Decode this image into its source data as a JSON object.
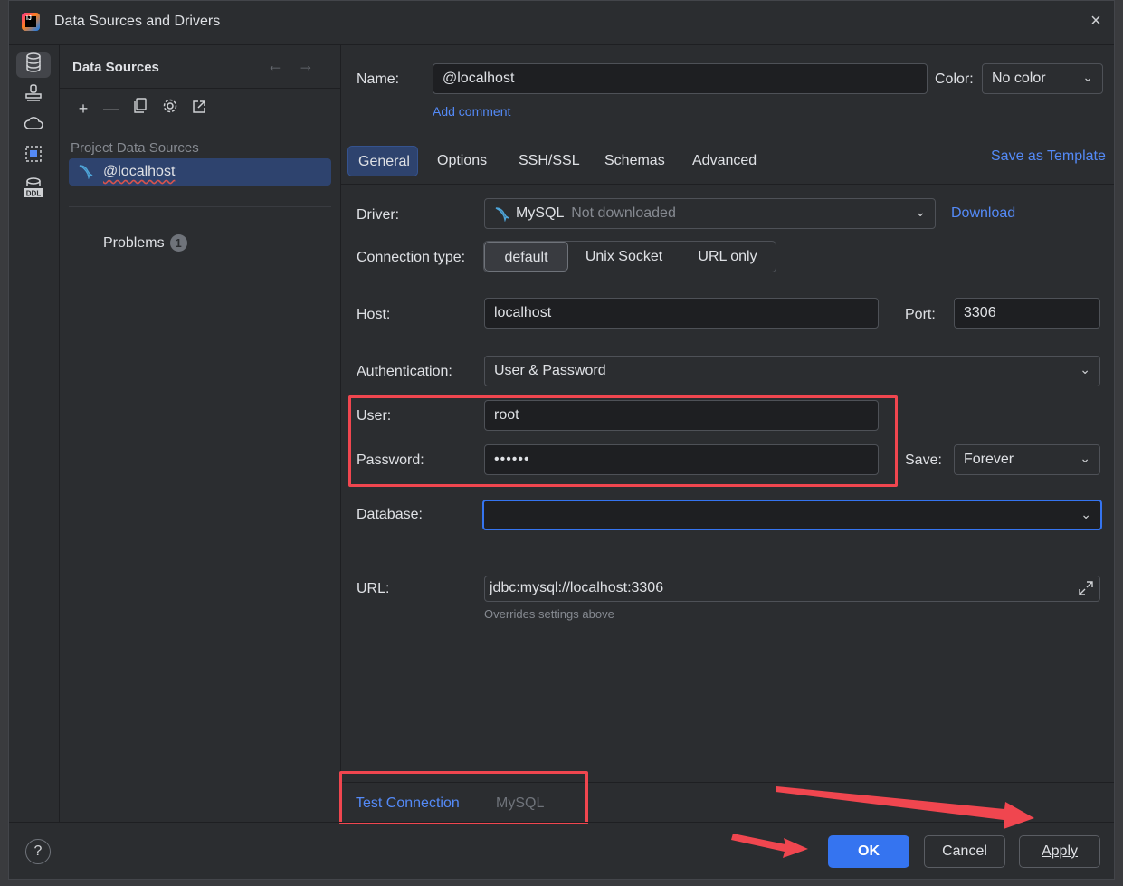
{
  "window": {
    "title": "Data Sources and Drivers",
    "close_icon": "×"
  },
  "left_panel": {
    "title": "Data Sources",
    "section_label": "Project Data Sources",
    "selected_item": "@localhost",
    "problems_label": "Problems",
    "problems_count": "1"
  },
  "form": {
    "name_label": "Name:",
    "name_value": "@localhost",
    "color_label": "Color:",
    "color_value": "No color",
    "add_comment": "Add comment",
    "save_as_template": "Save as Template",
    "tabs": [
      "General",
      "Options",
      "SSH/SSL",
      "Schemas",
      "Advanced"
    ],
    "driver_label": "Driver:",
    "driver_name": "MySQL",
    "driver_status": "Not downloaded",
    "download_link": "Download",
    "connection_type_label": "Connection type:",
    "connection_types": [
      "default",
      "Unix Socket",
      "URL only"
    ],
    "host_label": "Host:",
    "host_value": "localhost",
    "port_label": "Port:",
    "port_value": "3306",
    "auth_label": "Authentication:",
    "auth_value": "User & Password",
    "user_label": "User:",
    "user_value": "root",
    "password_label": "Password:",
    "password_value": "••••••",
    "save_label": "Save:",
    "save_value": "Forever",
    "database_label": "Database:",
    "database_value": "",
    "url_label": "URL:",
    "url_value": "jdbc:mysql://localhost:3306",
    "url_hint": "Overrides settings above",
    "test_connection": "Test Connection",
    "test_driver": "MySQL"
  },
  "footer": {
    "help": "?",
    "ok": "OK",
    "cancel": "Cancel",
    "apply": "Apply"
  },
  "colors": {
    "accent": "#3574f0",
    "link": "#548af7",
    "annotation": "#f0464f",
    "selection": "#2e436e"
  }
}
